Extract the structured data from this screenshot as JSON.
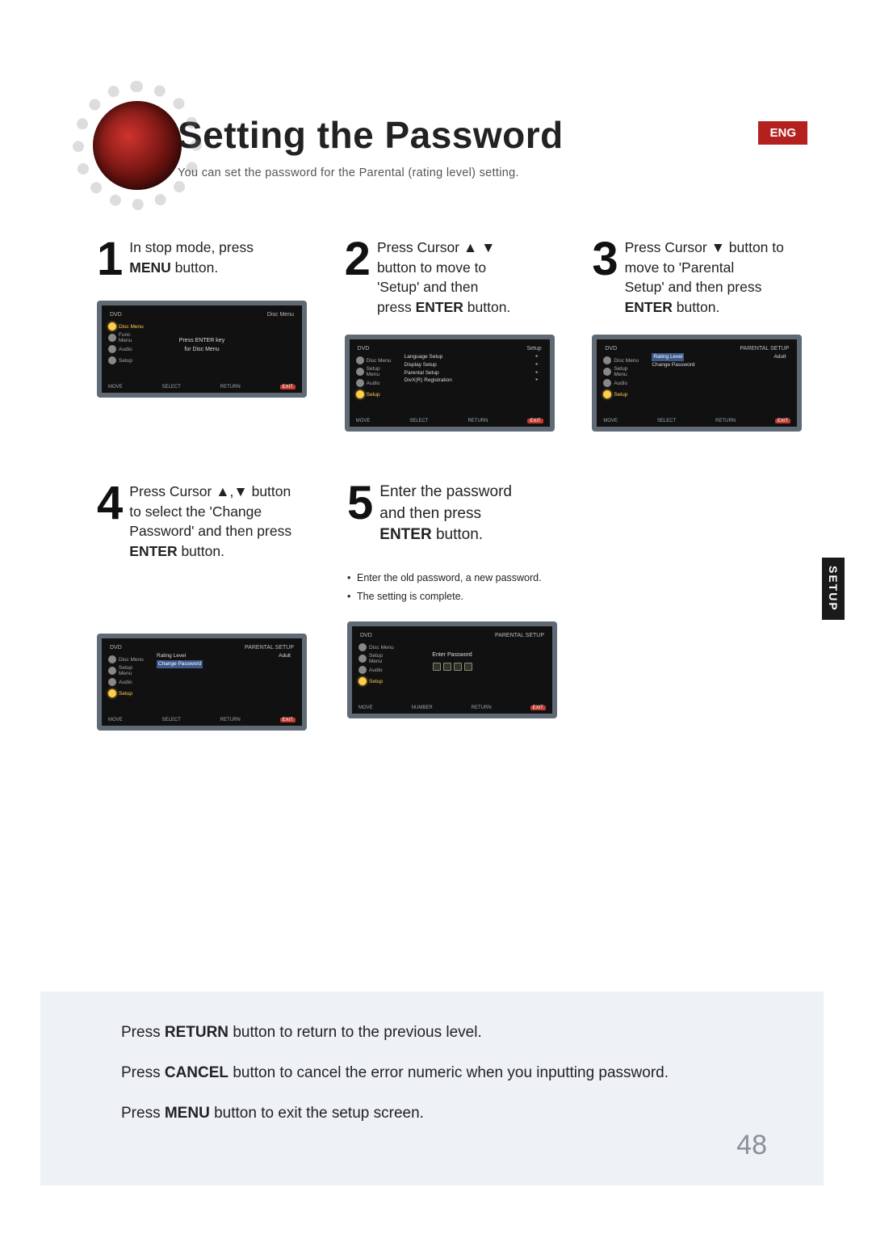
{
  "header": {
    "title": "Setting the Password",
    "subtitle": "You can set the password for the Parental (rating level) setting.",
    "lang_badge": "ENG"
  },
  "side_tab": "SETUP",
  "steps": [
    {
      "num": "1",
      "text_pre": "In stop mode, press ",
      "bold1": "MENU",
      "text_post": "  button.",
      "tv": {
        "top_left": "DVD",
        "top_right": "Disc Menu",
        "center_line1": "Press ENTER key",
        "center_line2": "for Disc Menu",
        "left_items": [
          "Disc Menu",
          "Func Menu",
          "Audio",
          "Setup"
        ],
        "sel_index": 0,
        "bottom": [
          "MOVE",
          "SELECT",
          "RETURN",
          "EXIT"
        ]
      }
    },
    {
      "num": "2",
      "line1": "Press Cursor ▲ ▼",
      "line2": "button to move to",
      "line3": "'Setup' and then",
      "line4_pre": "press ",
      "line4_bold": "ENTER",
      "line4_post": " button.",
      "tv": {
        "top_left": "DVD",
        "top_right": "Setup",
        "menu_items": [
          "Language Setup",
          "Display Setup",
          "Parental Setup",
          "DivX(R) Registration"
        ],
        "left_items": [
          "Disc Menu",
          "Setup Menu",
          "Audio",
          "Setup"
        ],
        "sel_index": 3,
        "bottom": [
          "MOVE",
          "SELECT",
          "RETURN",
          "EXIT"
        ]
      }
    },
    {
      "num": "3",
      "line1": "Press Cursor ▼ button to",
      "line2": "move to 'Parental",
      "line3_pre": "Setup'  and then press",
      "line4_bold": "ENTER",
      "line4_post": " button.",
      "tv": {
        "top_left": "DVD",
        "top_right": "PARENTAL SETUP",
        "rows": [
          {
            "label": "Rating Level",
            "value": "Adult",
            "hl": true
          },
          {
            "label": "Change Password",
            "value": ""
          }
        ],
        "left_items": [
          "Disc Menu",
          "Setup Menu",
          "Audio",
          "Setup"
        ],
        "sel_index": 3,
        "bottom": [
          "MOVE",
          "SELECT",
          "RETURN",
          "EXIT"
        ]
      }
    },
    {
      "num": "4",
      "line1": "Press Cursor ▲,▼ button",
      "line2": "to select the 'Change",
      "line3": "Password' and then press",
      "line4_bold": "ENTER",
      "line4_post": " button.",
      "tv": {
        "top_left": "DVD",
        "top_right": "PARENTAL SETUP",
        "rows": [
          {
            "label": "Rating Level",
            "value": "Adult"
          },
          {
            "label": "Change Password",
            "value": "",
            "hl": true
          }
        ],
        "left_items": [
          "Disc Menu",
          "Setup Menu",
          "Audio",
          "Setup"
        ],
        "sel_index": 3,
        "bottom": [
          "MOVE",
          "SELECT",
          "RETURN",
          "EXIT"
        ]
      }
    },
    {
      "num": "5",
      "line1": "Enter the password",
      "line2": "and then press",
      "line3_bold": "ENTER",
      "line3_post": " button.",
      "bullets": [
        "Enter the old password, a new password.",
        "The setting is complete."
      ],
      "tv": {
        "top_left": "DVD",
        "top_right": "PARENTAL SETUP",
        "enter_label": "Enter Password",
        "left_items": [
          "Disc Menu",
          "Setup Menu",
          "Audio",
          "Setup"
        ],
        "sel_index": 3,
        "bottom": [
          "MOVE",
          "NUMBER",
          "RETURN",
          "EXIT"
        ]
      }
    }
  ],
  "footer": {
    "line1_pre": "Press ",
    "line1_bold": "RETURN",
    "line1_post": " button to return to the previous level.",
    "line2_pre": "Press ",
    "line2_bold": "CANCEL",
    "line2_post": " button to cancel the error numeric when you inputting password.",
    "line3_pre": "Press ",
    "line3_bold": "MENU",
    "line3_post": " button to exit the setup screen."
  },
  "page_number": "48"
}
